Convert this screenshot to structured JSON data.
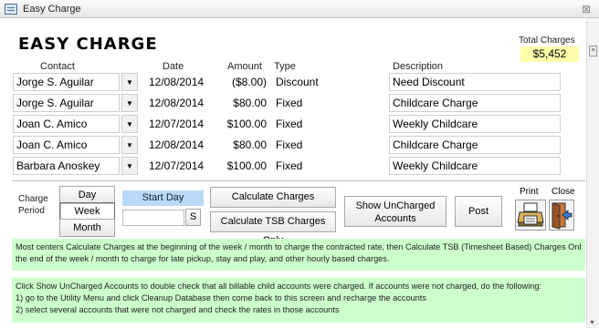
{
  "window": {
    "title": "Easy Charge",
    "close_glyph": "⊠"
  },
  "header": {
    "title": "EASY CHARGE",
    "total_label": "Total Charges",
    "total_value": "$5,452"
  },
  "columns": {
    "contact": "Contact",
    "date": "Date",
    "amount": "Amount",
    "type": "Type",
    "description": "Description"
  },
  "rows": [
    {
      "contact": "Jorge S. Aguilar",
      "date": "12/08/2014",
      "amount": "($8.00)",
      "type": "Discount",
      "description": "Need Discount"
    },
    {
      "contact": "Jorge S. Aguilar",
      "date": "12/08/2014",
      "amount": "$80.00",
      "type": "Fixed",
      "description": "Childcare Charge"
    },
    {
      "contact": "Joan C. Amico",
      "date": "12/07/2014",
      "amount": "$100.00",
      "type": "Fixed",
      "description": "Weekly Childcare"
    },
    {
      "contact": "Joan C. Amico",
      "date": "12/08/2014",
      "amount": "$80.00",
      "type": "Fixed",
      "description": "Childcare Charge"
    },
    {
      "contact": "Barbara Anoskey",
      "date": "12/07/2014",
      "amount": "$100.00",
      "type": "Fixed",
      "description": "Weekly Childcare"
    }
  ],
  "dropdown_glyph": "▼",
  "charge_period": {
    "label_line1": "Charge",
    "label_line2": "Period",
    "options": [
      "Day",
      "Week",
      "Month"
    ],
    "selected": "Week"
  },
  "start_day": {
    "label": "Start Day",
    "value": "",
    "s_button": "S"
  },
  "buttons": {
    "calculate": "Calculate Charges",
    "calculate_tsb": "Calculate TSB  Charges Only",
    "show_uncharged": "Show UnCharged\nAccounts",
    "post": "Post",
    "print": "Print",
    "close": "Close"
  },
  "notes": {
    "note1": [
      "Most centers Calculate Charges at the beginning of the week / month to charge the contracted rate, then Calculate TSB (Timesheet Based) Charges Only at",
      "the end of the week / month to charge for late pickup, stay and play, and other hourly based charges."
    ],
    "note2": [
      "Click Show UnCharged Accounts to double check that all billable child accounts were charged. If accounts were not charged, do the following:",
      "1) go to the Utility Menu and click Cleanup Database then come back to this screen and recharge the accounts",
      "2) select several accounts that were not charged and check the rates in those accounts"
    ]
  },
  "colors": {
    "total_bg": "#ffffaa",
    "start_day_bg": "#b9d9f7",
    "note_bg": "#ccffcc"
  },
  "icons": [
    "window-icon",
    "close-icon",
    "chevron-down-icon",
    "printer-icon",
    "exit-door-icon"
  ]
}
